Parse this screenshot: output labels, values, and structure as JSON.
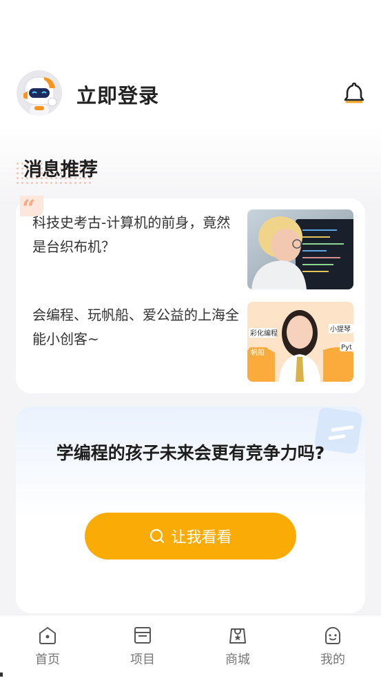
{
  "header": {
    "login_label": "立即登录",
    "avatar_icon": "robot-avatar-icon",
    "bell_icon": "bell-icon"
  },
  "news": {
    "title": "消息推荐",
    "items": [
      {
        "text": "科技史考古-计算机的前身，竟然是台织布机？"
      },
      {
        "text": "会编程、玩帆船、爱公益的上海全能小创客~"
      }
    ],
    "thumb_labels": [
      "彩化编程",
      "帆船",
      "小提琴",
      "Pyt"
    ]
  },
  "promo": {
    "title": "学编程的孩子未来会更有竞争力吗?",
    "button_label": "让我看看"
  },
  "tabbar": {
    "items": [
      {
        "label": "首页",
        "icon": "home-icon"
      },
      {
        "label": "项目",
        "icon": "project-icon"
      },
      {
        "label": "商城",
        "icon": "shop-icon"
      },
      {
        "label": "我的",
        "icon": "profile-icon"
      }
    ]
  },
  "colors": {
    "accent": "#fbab06",
    "background": "#f4f4f6",
    "bell_accent": "#f5a623"
  }
}
